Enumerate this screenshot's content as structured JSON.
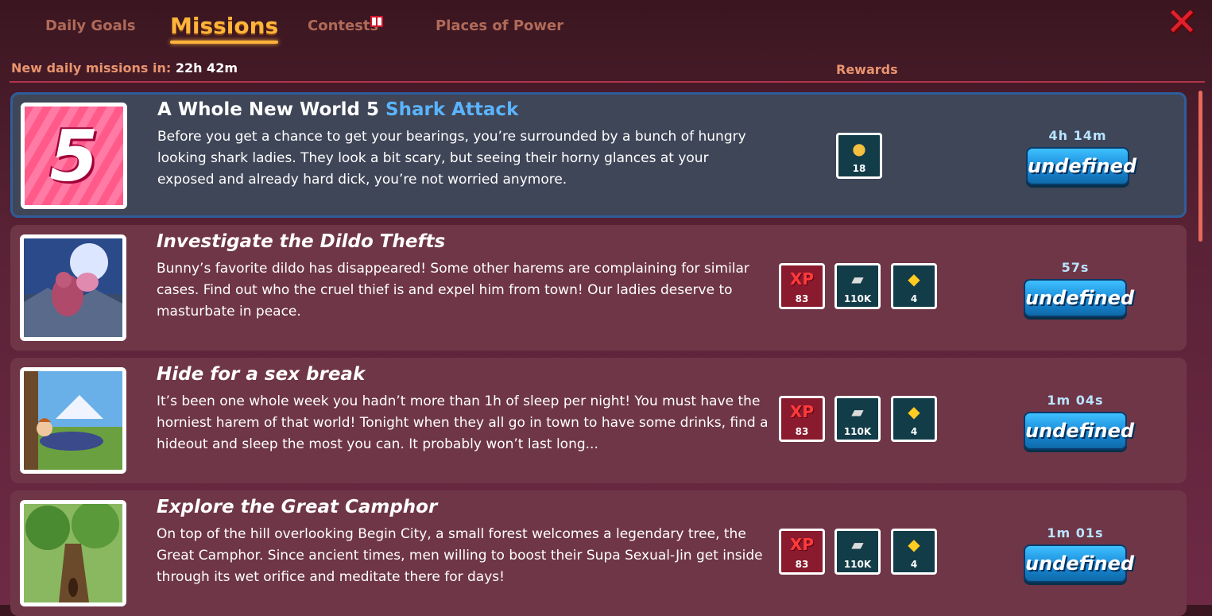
{
  "tabs": [
    {
      "label": "Daily Goals"
    },
    {
      "label": "Missions"
    },
    {
      "label": "Contests"
    },
    {
      "label": "Places of Power"
    }
  ],
  "close_icon": "close-x-icon",
  "header": {
    "countdown_label": "New daily missions in:",
    "countdown_value": "22h 42m",
    "rewards_label": "Rewards"
  },
  "missions": [
    {
      "thumb": "number-5-badge",
      "thumb_number": "5",
      "title": "A Whole New World 5",
      "subtitle": "Shark Attack",
      "description": "Before you get a chance to get your bearings, you’re surrounded by a bunch of hungry looking shark ladies. They look a bit scary, but seeing their horny glances at your exposed and already hard dick, you’re not worried anymore.",
      "rewards": [
        {
          "type": "coin-icon",
          "amount": "18"
        }
      ],
      "timer": "4h 14m",
      "button": "undefined"
    },
    {
      "thumb": "thief-moon-image",
      "title": "Investigate the Dildo Thefts",
      "description": "Bunny’s favorite dildo has disappeared! Some other harems are complaining for similar cases. Find out who the cruel thief is and expel him from town! Our ladies deserve to masturbate in peace.",
      "rewards": [
        {
          "type": "xp",
          "label": "XP",
          "amount": "83"
        },
        {
          "type": "cash-icon",
          "amount": "110K"
        },
        {
          "type": "gem-icon",
          "amount": "4"
        }
      ],
      "timer": "57s",
      "button": "undefined"
    },
    {
      "thumb": "sleeping-man-image",
      "title": "Hide for a sex break",
      "description": "It’s been one whole week you hadn’t more than 1h of sleep per night! You must have the horniest harem of that world! Tonight when they all go in town to have some drinks, find a hideout and sleep the most you can. It probably won’t last long...",
      "rewards": [
        {
          "type": "xp",
          "label": "XP",
          "amount": "83"
        },
        {
          "type": "cash-icon",
          "amount": "110K"
        },
        {
          "type": "gem-icon",
          "amount": "4"
        }
      ],
      "timer": "1m 04s",
      "button": "undefined"
    },
    {
      "thumb": "camphor-tree-image",
      "title": "Explore the Great Camphor",
      "description": "On top of the hill overlooking Begin City, a small forest welcomes a legendary tree, the Great Camphor. Since ancient times, men willing to boost their Supa Sexual-Jin get inside through its wet orifice and meditate there for days!",
      "rewards": [
        {
          "type": "xp",
          "label": "XP",
          "amount": "83"
        },
        {
          "type": "cash-icon",
          "amount": "110K"
        },
        {
          "type": "gem-icon",
          "amount": "4"
        }
      ],
      "timer": "1m 01s",
      "button": "undefined"
    }
  ]
}
